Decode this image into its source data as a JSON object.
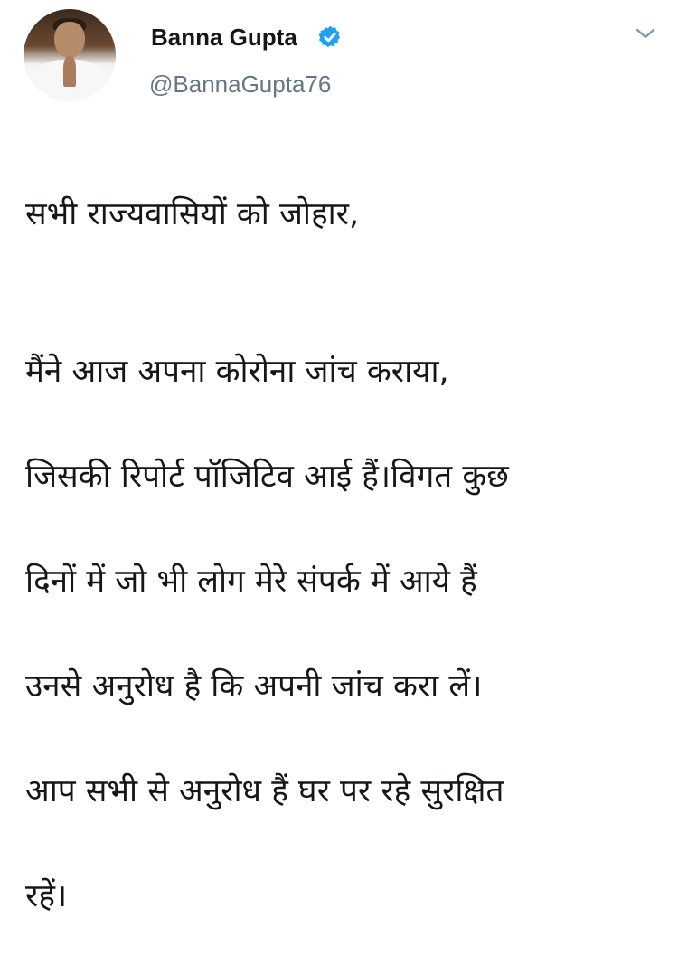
{
  "tweet": {
    "author": {
      "name": "Banna Gupta",
      "handle": "@BannaGupta76",
      "verified": true,
      "verified_color": "#1da1f2",
      "avatar_icon": "profile-photo"
    },
    "menu_icon": "chevron-down-icon",
    "lines": {
      "greeting": "सभी राज्यवासियों को जोहार,",
      "line1": "मैंने आज अपना कोरोना जांच कराया,",
      "line2": "जिसकी रिपोर्ट पॉजिटिव आई हैं।विगत कुछ",
      "line3": "दिनों में जो भी लोग मेरे संपर्क में आये हैं",
      "line4": "उनसे अनुरोध है कि अपनी जांच करा लें।",
      "line5": "आप सभी से अनुरोध हैं घर पर रहे सुरक्षित",
      "line6": "रहें।"
    }
  }
}
